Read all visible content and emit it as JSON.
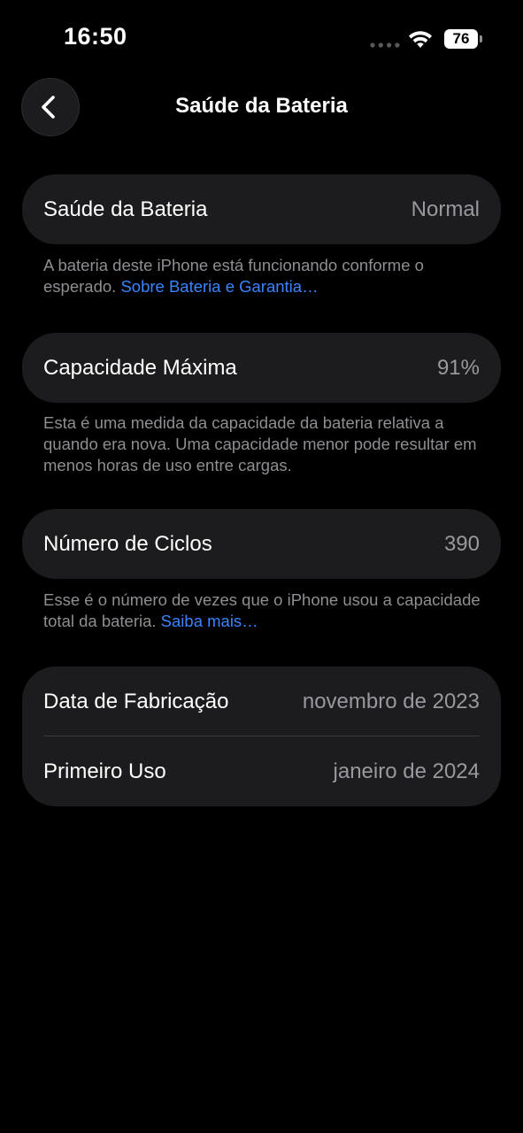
{
  "status_bar": {
    "time": "16:50",
    "battery_level": "76",
    "signal_icon": "signal-dots-icon",
    "wifi_icon": "wifi-icon",
    "battery_icon": "battery-icon"
  },
  "nav": {
    "back_icon": "chevron-left-icon",
    "title": "Saúde da Bateria"
  },
  "health": {
    "label": "Saúde da Bateria",
    "value": "Normal",
    "footnote_text": "A bateria deste iPhone está funcionando conforme o esperado. ",
    "footnote_link": "Sobre Bateria e Garantia…"
  },
  "capacity": {
    "label": "Capacidade Máxima",
    "value": "91%",
    "footnote_text": "Esta é uma medida da capacidade da bateria relativa a quando era nova. Uma capacidade menor pode resultar em menos horas de uso entre cargas."
  },
  "cycles": {
    "label": "Número de Ciclos",
    "value": "390",
    "footnote_text": "Esse é o número de vezes que o iPhone usou a capacidade total da bateria. ",
    "footnote_link": "Saiba mais…"
  },
  "dates": {
    "manufacture_label": "Data de Fabricação",
    "manufacture_value": "novembro de 2023",
    "first_use_label": "Primeiro Uso",
    "first_use_value": "janeiro de 2024"
  },
  "colors": {
    "background": "#000000",
    "card": "#1c1c1e",
    "secondary_text": "#98989f",
    "link": "#3a84ff"
  }
}
